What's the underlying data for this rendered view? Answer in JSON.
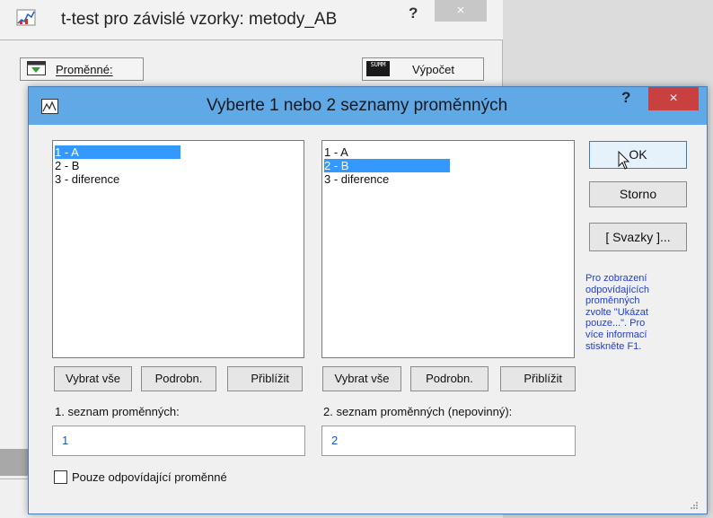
{
  "background_window": {
    "title": "t-test pro závislé vzorky: metody_AB",
    "help_glyph": "?",
    "close_glyph": "×",
    "variables_button": "Proměnné:",
    "compute_button": "Výpočet",
    "sum_icon_text": "SUMM"
  },
  "dialog": {
    "title": "Vyberte 1 nebo 2 seznamy proměnných",
    "help_glyph": "?",
    "close_glyph": "×",
    "list1": {
      "items": [
        "1 - A",
        "2 - B",
        "3 - diference"
      ],
      "selected_index": 0,
      "buttons": {
        "select_all": "Vybrat vše",
        "details": "Podrobn.",
        "zoom": "Přiblížit"
      },
      "label": "1. seznam proměnných:",
      "value": "1"
    },
    "list2": {
      "items": [
        "1 - A",
        "2 - B",
        "3 - diference"
      ],
      "selected_index": 1,
      "buttons": {
        "select_all": "Vybrat vše",
        "details": "Podrobn.",
        "zoom": "Přiblížit"
      },
      "label": "2. seznam proměnných (nepovinný):",
      "value": "2"
    },
    "ok_button": "OK",
    "cancel_button": "Storno",
    "bundles_button": "[ Svazky ]...",
    "info_text": [
      "Pro zobrazení",
      "odpovídajících",
      "proměnných",
      "zvolte \"Ukázat",
      "pouze...\". Pro",
      "více informací",
      "stiskněte F1."
    ],
    "checkbox": {
      "label": "Pouze odpovídající proměnné",
      "checked": false
    },
    "colors": {
      "titlebar": "#61a8e6",
      "close": "#c94040",
      "selection": "#3399ff",
      "info": "#1f3fd6",
      "field_text": "#1a5ab8"
    }
  }
}
